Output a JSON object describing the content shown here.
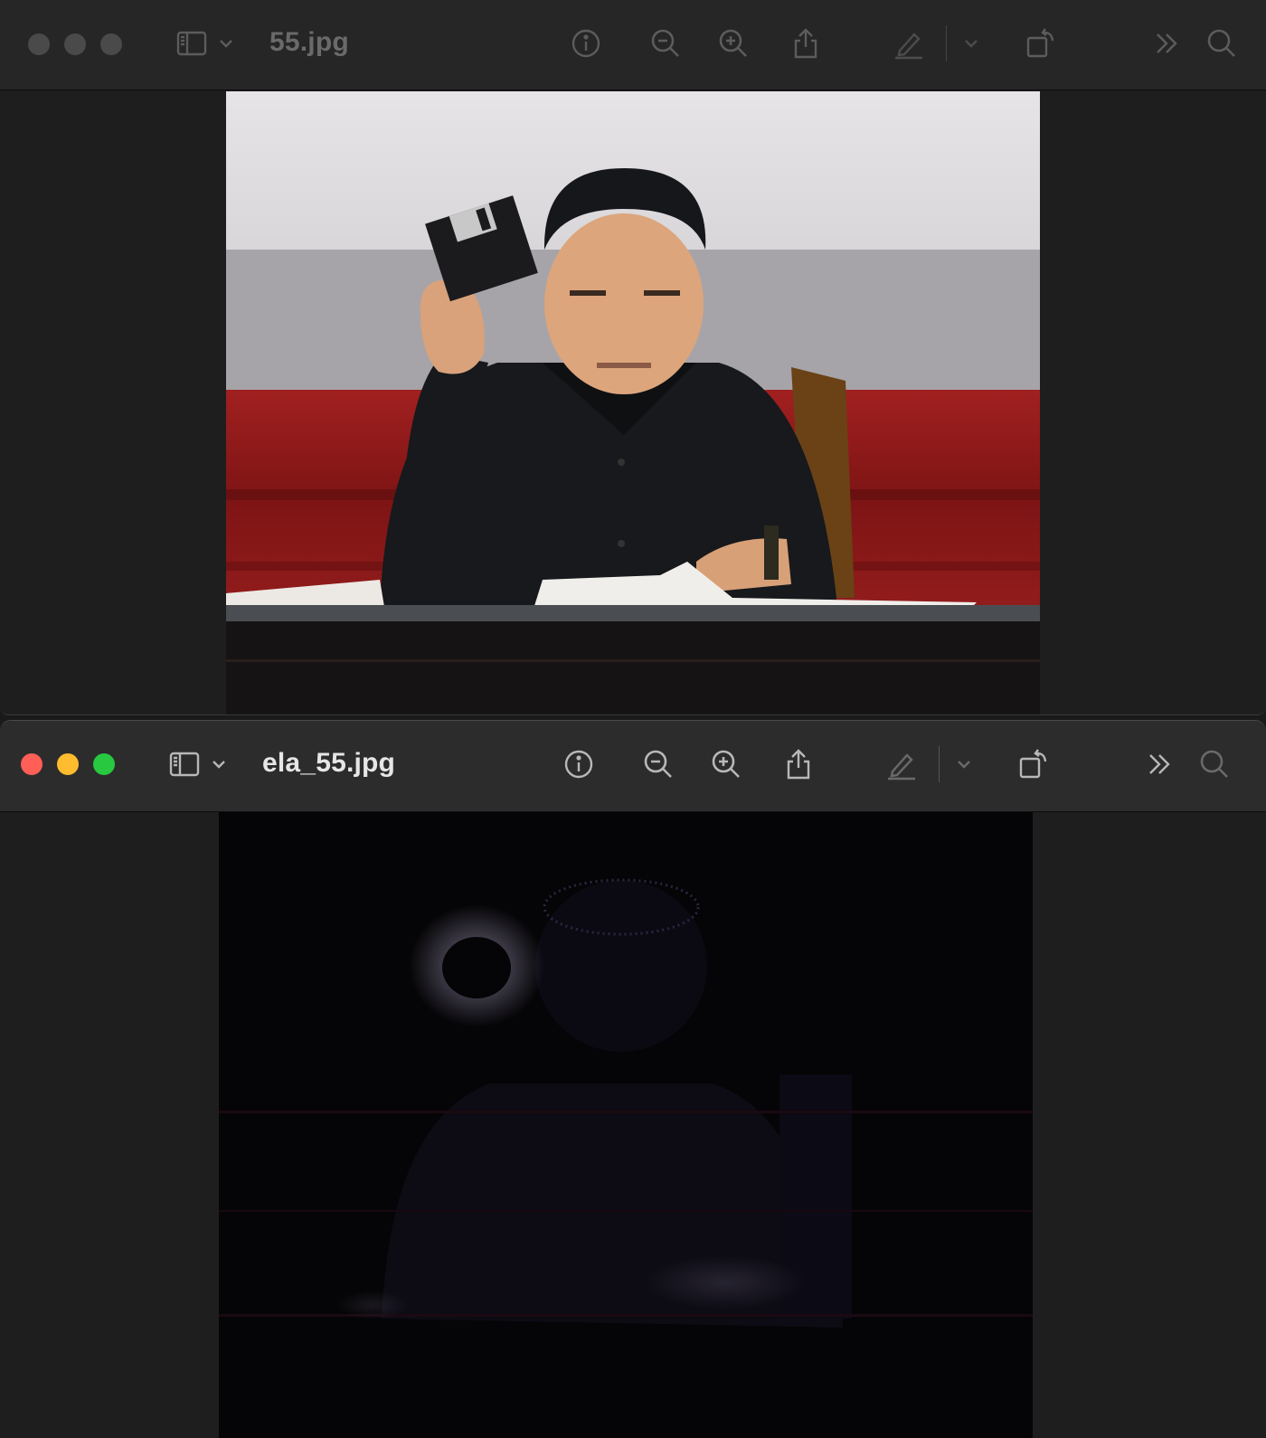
{
  "windows": [
    {
      "title": "55.jpg",
      "active": false,
      "image": "original photo: man seated at desk holding a floppy disk"
    },
    {
      "title": "ela_55.jpg",
      "active": true,
      "image": "error level analysis result: mostly black with bright noise around the floppy disk"
    }
  ],
  "toolbar_icons": [
    "sidebar-icon",
    "chevron-down-icon",
    "info-icon",
    "zoom-out-icon",
    "zoom-in-icon",
    "share-icon",
    "markup-pen-icon",
    "chevron-down-icon",
    "rotate-icon",
    "more-chevrons-icon",
    "search-icon"
  ],
  "colors": {
    "close": "#ff5f57",
    "minimize": "#febc2e",
    "zoom": "#28c840",
    "inactive_light": "#4a4a4a",
    "inactive_icon": "#5c5c5c",
    "active_icon": "#b8b8b8",
    "active_title": "#e6e6e6",
    "inactive_title": "#6a6a6a"
  }
}
